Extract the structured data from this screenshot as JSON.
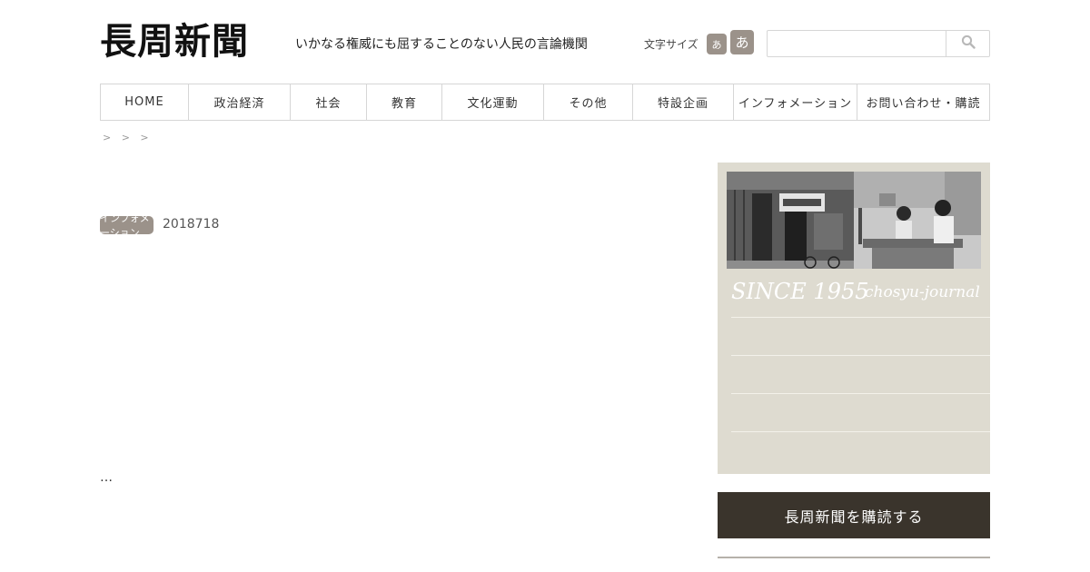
{
  "header": {
    "logo": "長周新聞",
    "tagline": "いかなる権威にも屈することのない人民の言論機関",
    "font_size_label": "文字サイズ",
    "font_small": "あ",
    "font_large": "あ",
    "search_placeholder": ""
  },
  "nav": {
    "items": [
      {
        "label": "HOME"
      },
      {
        "label": "政治経済"
      },
      {
        "label": "社会"
      },
      {
        "label": "教育"
      },
      {
        "label": "文化運動"
      },
      {
        "label": "その他"
      },
      {
        "label": "特設企画"
      },
      {
        "label": "インフォメーション"
      },
      {
        "label": "お問い合わせ・購読"
      }
    ]
  },
  "breadcrumb": "> > >",
  "article": {
    "category": "インフォメーション",
    "date": "2018718",
    "excerpt": "…"
  },
  "sidebar": {
    "since": "SINCE 1955",
    "since_sub": "chosyu-journal",
    "links": [
      "",
      "",
      "",
      ""
    ],
    "button_label": "長周新聞を購読する"
  },
  "colors": {
    "accent_badge": "#9b928a",
    "sidebar_bg": "#dedbd0",
    "dark_button": "#3a342c"
  }
}
